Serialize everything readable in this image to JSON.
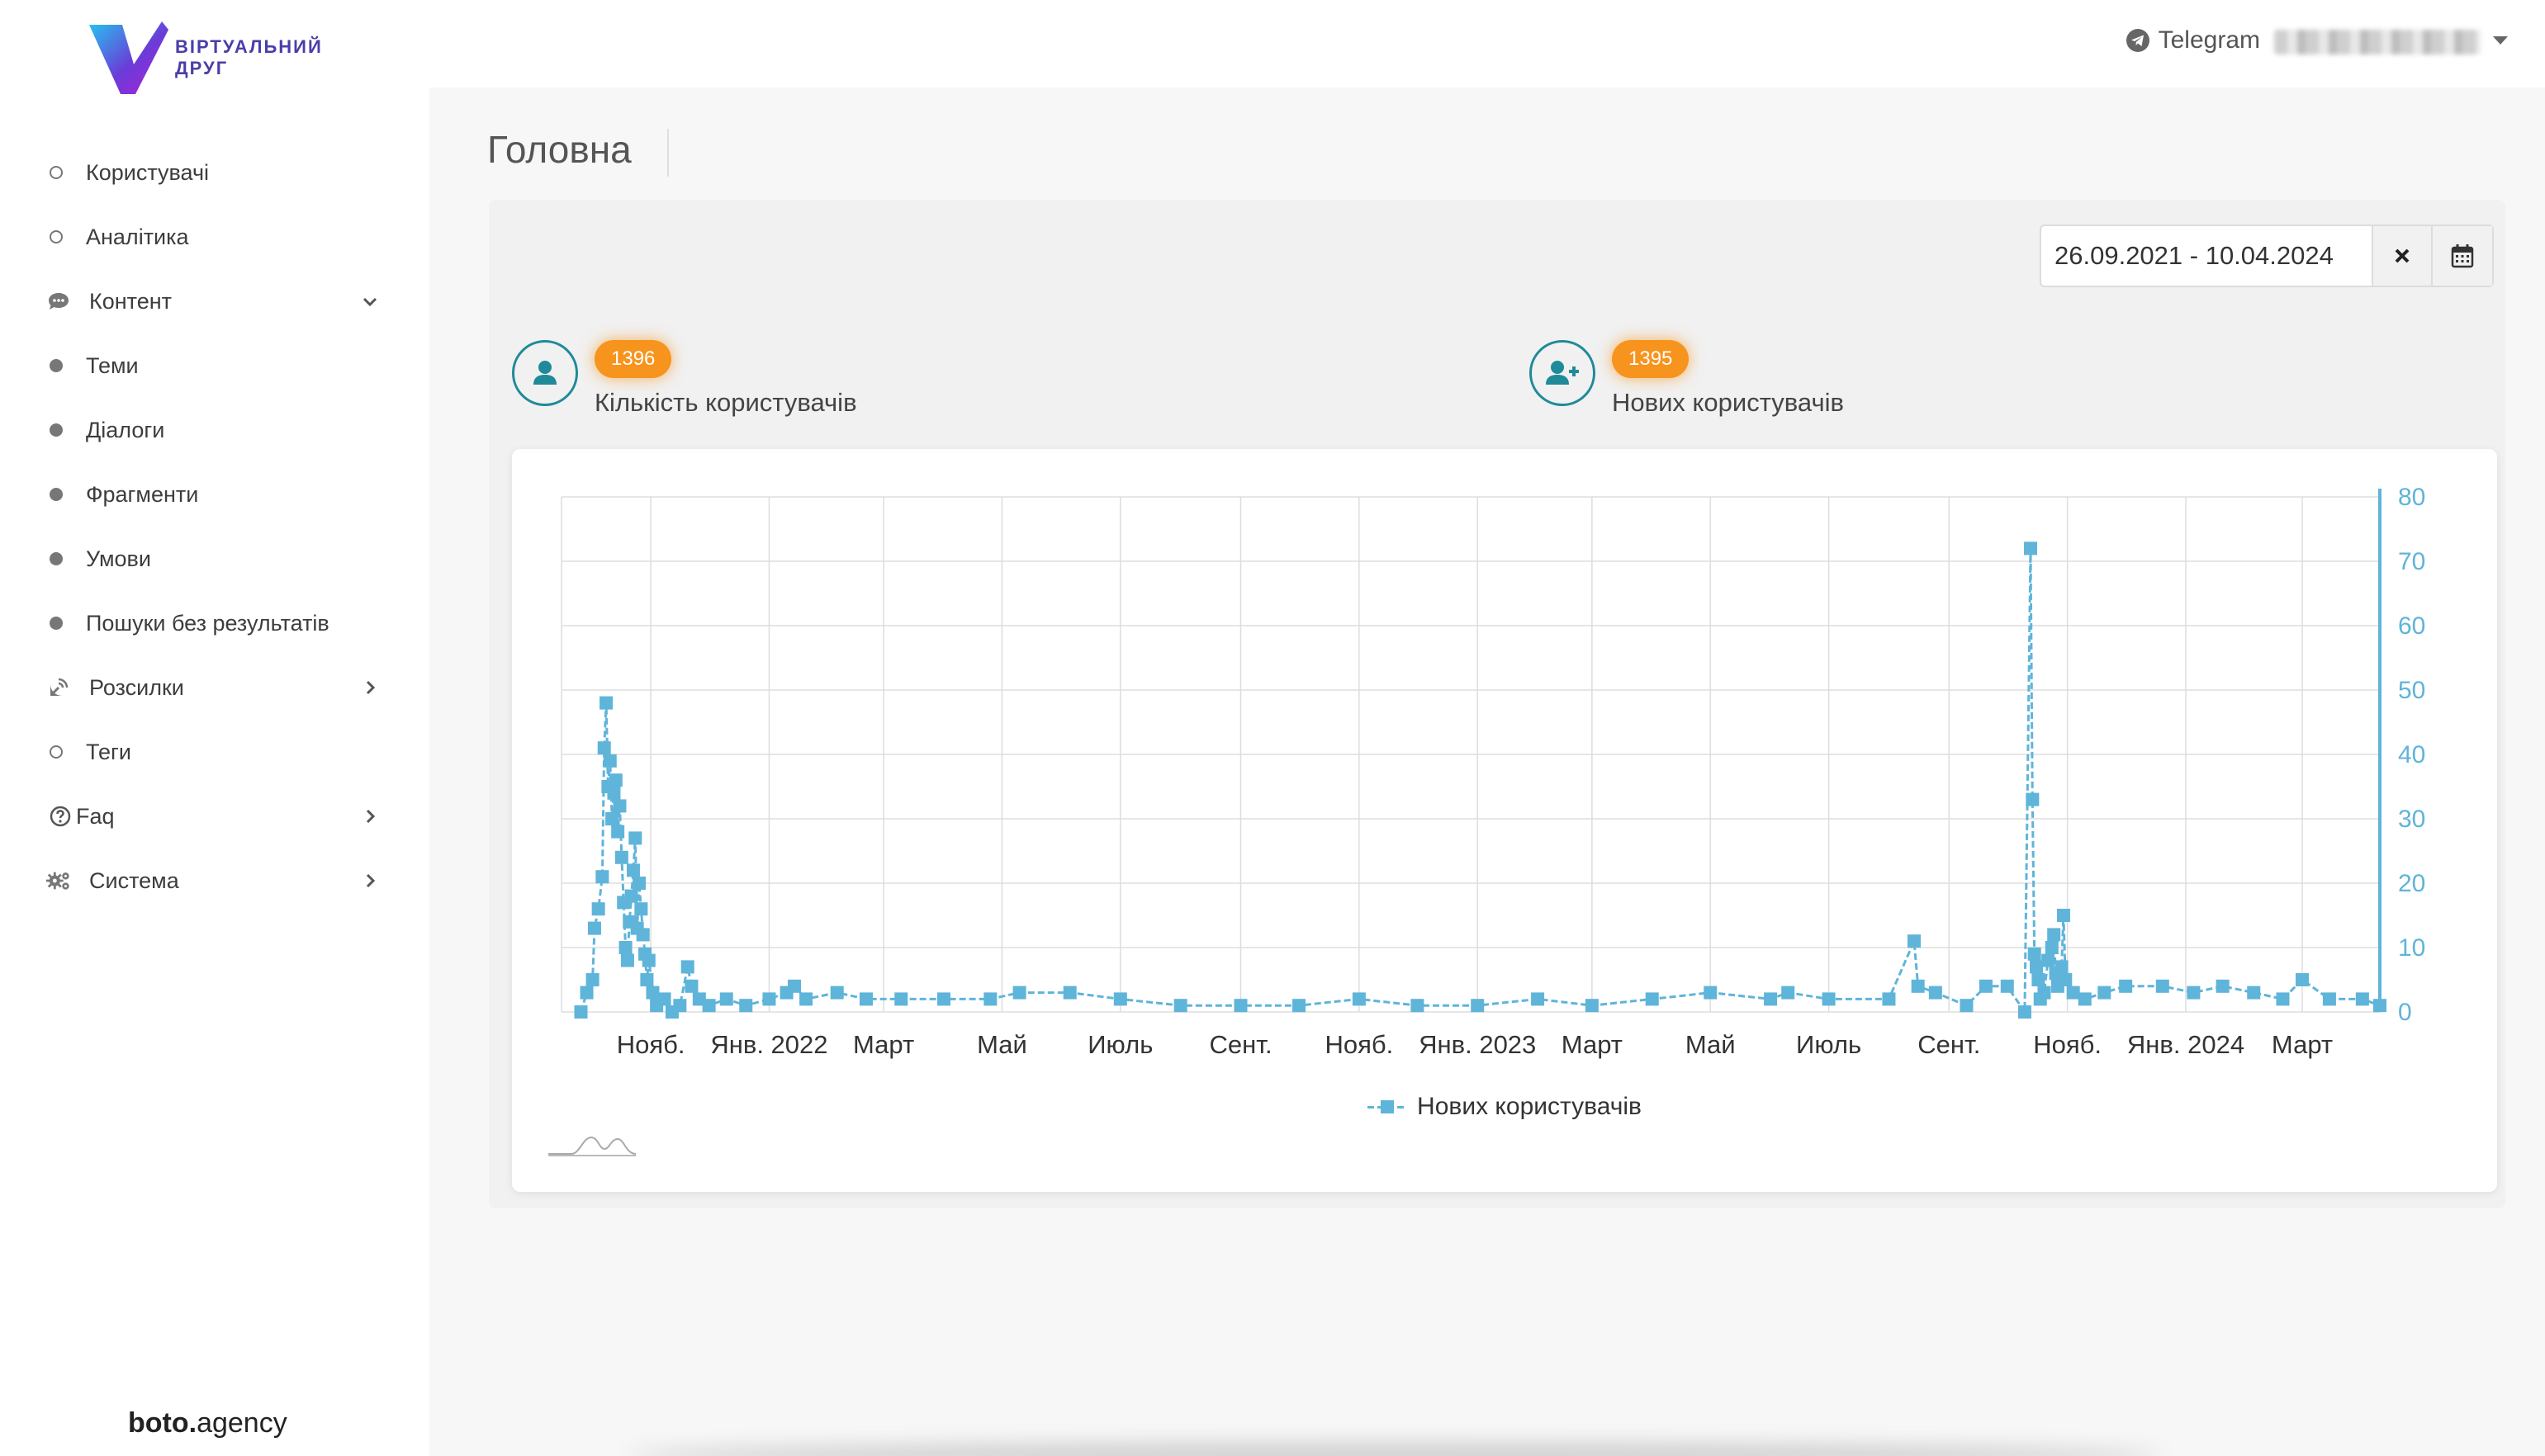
{
  "logo": {
    "text": "ВІРТУАЛЬНИЙ\nДРУГ"
  },
  "sidebar": {
    "items": [
      {
        "label": "Користувачі",
        "bullet": "hollow"
      },
      {
        "label": "Аналітика",
        "bullet": "hollow"
      },
      {
        "label": "Контент",
        "icon": "chat-icon",
        "chevron": "down"
      },
      {
        "label": "Теми",
        "bullet": "filled"
      },
      {
        "label": "Діалоги",
        "bullet": "filled"
      },
      {
        "label": "Фрагменти",
        "bullet": "filled"
      },
      {
        "label": "Умови",
        "bullet": "filled"
      },
      {
        "label": "Пошуки без результатів",
        "bullet": "filled"
      },
      {
        "label": "Розсилки",
        "icon": "satellite-icon",
        "chevron": "right"
      },
      {
        "label": "Теги",
        "bullet": "hollow"
      },
      {
        "label": "Faq",
        "icon": "question-icon",
        "chevron": "right"
      },
      {
        "label": "Система",
        "icon": "gears-icon",
        "chevron": "right"
      }
    ],
    "footer_brand_bold": "boto.",
    "footer_brand_light": "agency"
  },
  "topbar": {
    "telegram_label": "Telegram"
  },
  "page": {
    "title": "Головна"
  },
  "filter": {
    "date_range": "26.09.2021 - 10.04.2024"
  },
  "stats": [
    {
      "value": "1396",
      "label": "Кількість користувачів"
    },
    {
      "value": "1395",
      "label": "Нових користувачів"
    }
  ],
  "colors": {
    "accent": "#f7941d",
    "teal": "#1f8a99",
    "series": "#5fb4d9"
  },
  "chart_data": {
    "type": "line",
    "title": "",
    "x_ticks": [
      "Нояб.",
      "Янв. 2022",
      "Март",
      "Май",
      "Июль",
      "Сент.",
      "Нояб.",
      "Янв. 2023",
      "Март",
      "Май",
      "Июль",
      "Сент.",
      "Нояб.",
      "Янв. 2024",
      "Март"
    ],
    "y_axis": {
      "position": "right",
      "min": 0,
      "max": 80,
      "ticks": [
        0,
        10,
        20,
        30,
        40,
        50,
        60,
        70,
        80
      ]
    },
    "grid": true,
    "legend": "bottom",
    "series": [
      {
        "name": "Нових користувачів",
        "points": [
          [
            "2021-09-26",
            0
          ],
          [
            "2021-09-29",
            3
          ],
          [
            "2021-10-02",
            5
          ],
          [
            "2021-10-03",
            13
          ],
          [
            "2021-10-05",
            16
          ],
          [
            "2021-10-07",
            21
          ],
          [
            "2021-10-08",
            41
          ],
          [
            "2021-10-09",
            48
          ],
          [
            "2021-10-10",
            35
          ],
          [
            "2021-10-11",
            39
          ],
          [
            "2021-10-12",
            30
          ],
          [
            "2021-10-13",
            34
          ],
          [
            "2021-10-14",
            36
          ],
          [
            "2021-10-15",
            28
          ],
          [
            "2021-10-16",
            32
          ],
          [
            "2021-10-17",
            24
          ],
          [
            "2021-10-18",
            17
          ],
          [
            "2021-10-19",
            10
          ],
          [
            "2021-10-20",
            8
          ],
          [
            "2021-10-21",
            14
          ],
          [
            "2021-10-22",
            18
          ],
          [
            "2021-10-23",
            22
          ],
          [
            "2021-10-24",
            27
          ],
          [
            "2021-10-25",
            13
          ],
          [
            "2021-10-26",
            20
          ],
          [
            "2021-10-27",
            16
          ],
          [
            "2021-10-28",
            12
          ],
          [
            "2021-10-29",
            9
          ],
          [
            "2021-10-30",
            5
          ],
          [
            "2021-10-31",
            8
          ],
          [
            "2021-11-02",
            3
          ],
          [
            "2021-11-04",
            1
          ],
          [
            "2021-11-08",
            2
          ],
          [
            "2021-11-12",
            0
          ],
          [
            "2021-11-16",
            1
          ],
          [
            "2021-11-20",
            7
          ],
          [
            "2021-11-22",
            4
          ],
          [
            "2021-11-26",
            2
          ],
          [
            "2021-12-01",
            1
          ],
          [
            "2021-12-10",
            2
          ],
          [
            "2021-12-20",
            1
          ],
          [
            "2022-01-01",
            2
          ],
          [
            "2022-01-10",
            3
          ],
          [
            "2022-01-14",
            4
          ],
          [
            "2022-01-20",
            2
          ],
          [
            "2022-02-05",
            3
          ],
          [
            "2022-02-20",
            2
          ],
          [
            "2022-03-10",
            2
          ],
          [
            "2022-04-01",
            2
          ],
          [
            "2022-04-25",
            2
          ],
          [
            "2022-05-10",
            3
          ],
          [
            "2022-06-05",
            3
          ],
          [
            "2022-07-01",
            2
          ],
          [
            "2022-08-01",
            1
          ],
          [
            "2022-09-01",
            1
          ],
          [
            "2022-10-01",
            1
          ],
          [
            "2022-11-01",
            2
          ],
          [
            "2022-12-01",
            1
          ],
          [
            "2023-01-01",
            1
          ],
          [
            "2023-02-01",
            2
          ],
          [
            "2023-03-01",
            1
          ],
          [
            "2023-04-01",
            2
          ],
          [
            "2023-05-01",
            3
          ],
          [
            "2023-06-01",
            2
          ],
          [
            "2023-06-10",
            3
          ],
          [
            "2023-07-01",
            2
          ],
          [
            "2023-08-01",
            2
          ],
          [
            "2023-08-14",
            11
          ],
          [
            "2023-08-16",
            4
          ],
          [
            "2023-08-25",
            3
          ],
          [
            "2023-09-10",
            1
          ],
          [
            "2023-09-20",
            4
          ],
          [
            "2023-10-01",
            4
          ],
          [
            "2023-10-10",
            0
          ],
          [
            "2023-10-13",
            72
          ],
          [
            "2023-10-14",
            33
          ],
          [
            "2023-10-15",
            9
          ],
          [
            "2023-10-16",
            7
          ],
          [
            "2023-10-17",
            5
          ],
          [
            "2023-10-18",
            2
          ],
          [
            "2023-10-20",
            3
          ],
          [
            "2023-10-22",
            8
          ],
          [
            "2023-10-24",
            10
          ],
          [
            "2023-10-25",
            12
          ],
          [
            "2023-10-26",
            6
          ],
          [
            "2023-10-27",
            4
          ],
          [
            "2023-10-29",
            7
          ],
          [
            "2023-10-30",
            15
          ],
          [
            "2023-10-31",
            5
          ],
          [
            "2023-11-04",
            3
          ],
          [
            "2023-11-10",
            2
          ],
          [
            "2023-11-20",
            3
          ],
          [
            "2023-12-01",
            4
          ],
          [
            "2023-12-20",
            4
          ],
          [
            "2024-01-05",
            3
          ],
          [
            "2024-01-20",
            4
          ],
          [
            "2024-02-05",
            3
          ],
          [
            "2024-02-20",
            2
          ],
          [
            "2024-03-01",
            5
          ],
          [
            "2024-03-15",
            2
          ],
          [
            "2024-04-01",
            2
          ],
          [
            "2024-04-10",
            1
          ]
        ]
      }
    ]
  }
}
